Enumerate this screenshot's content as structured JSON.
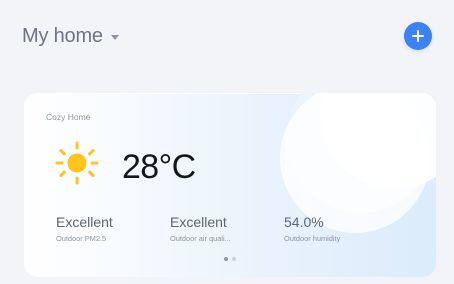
{
  "header": {
    "title": "My home"
  },
  "weather_card": {
    "location": "Cozy Home",
    "temperature": "28°C",
    "metrics": [
      {
        "value": "Excellent",
        "label": "Outdoor PM2.5"
      },
      {
        "value": "Excellent",
        "label": "Outdoor air quali..."
      },
      {
        "value": "54.0%",
        "label": "Outdoor humidity"
      }
    ],
    "pagination": {
      "active_index": 1,
      "count": 2
    }
  },
  "colors": {
    "background": "#f3f4f8",
    "accent": "#3b82f6",
    "sun": "#ffc51b",
    "temperature_text": "#121722"
  },
  "icons": {
    "add": "add-icon",
    "chevron": "chevron-down-icon",
    "weather": "sun-icon"
  }
}
